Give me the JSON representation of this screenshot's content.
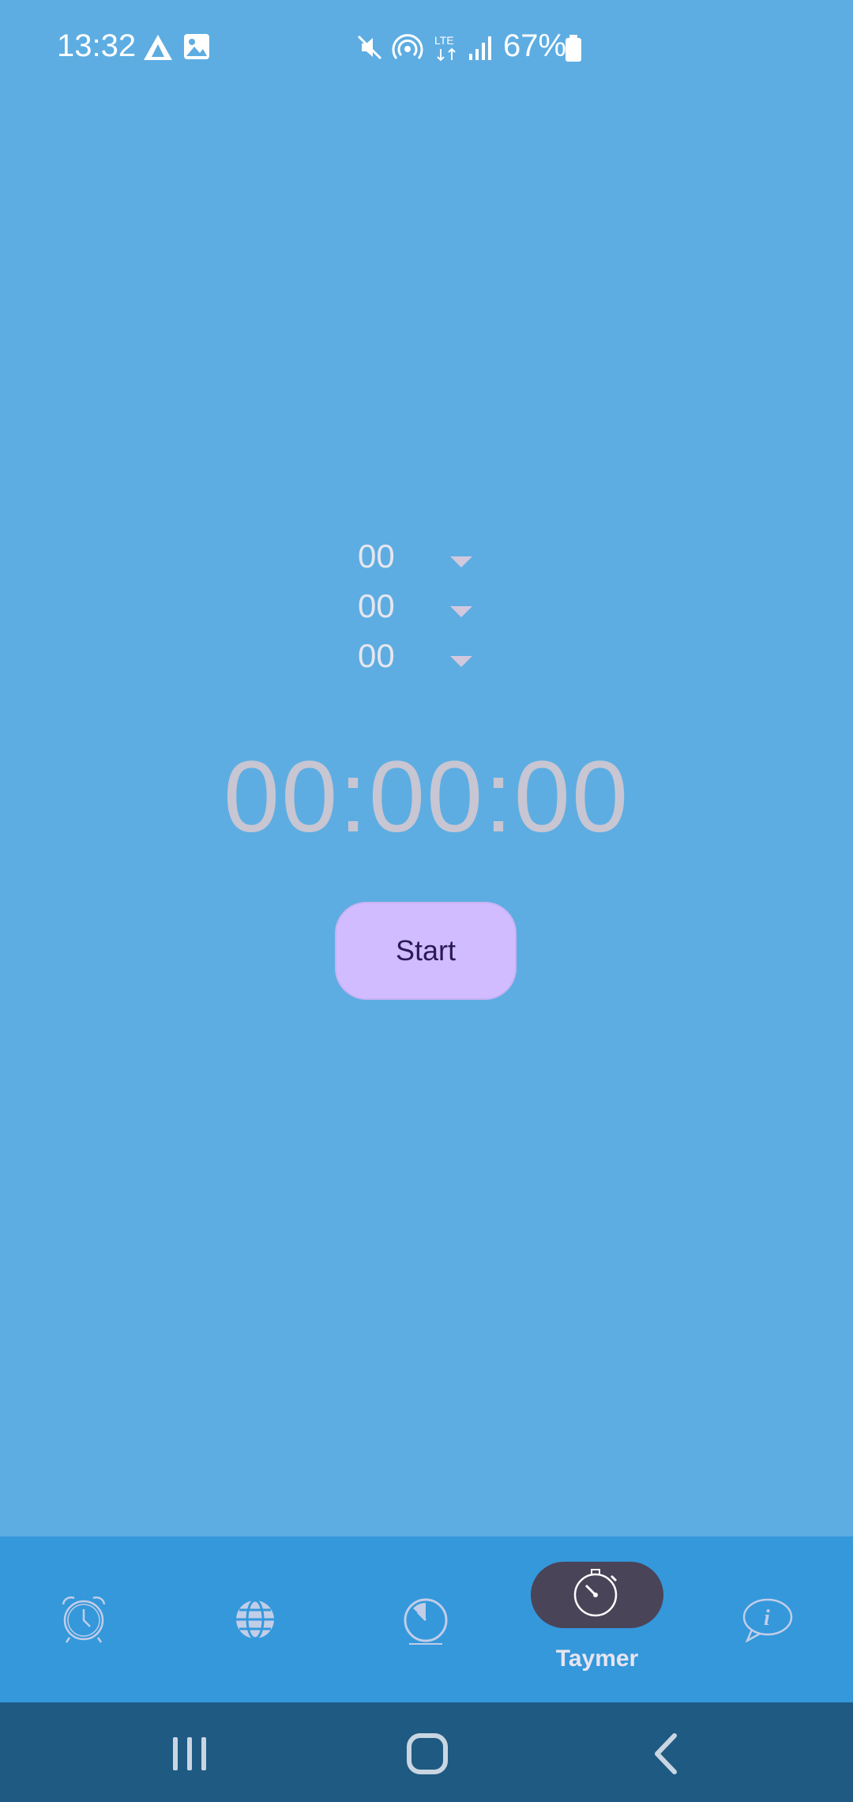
{
  "status_bar": {
    "time": "13:32",
    "battery_percent": "67%",
    "network_type": "LTE",
    "icons": [
      "drive-icon",
      "gallery-icon",
      "mute-icon",
      "hotspot-icon",
      "lte-icon",
      "signal-icon",
      "battery-icon"
    ]
  },
  "pickers": [
    {
      "value": "00",
      "icon": "dropdown-arrow-icon"
    },
    {
      "value": "00",
      "icon": "dropdown-arrow-icon"
    },
    {
      "value": "00",
      "icon": "dropdown-arrow-icon"
    }
  ],
  "timer": {
    "display": "00:00:00"
  },
  "start_button": {
    "label": "Start"
  },
  "bottom_nav": {
    "items": [
      {
        "icon": "alarm-clock-icon",
        "active": false
      },
      {
        "icon": "globe-icon",
        "active": false
      },
      {
        "icon": "clock-icon",
        "active": false
      },
      {
        "icon": "stopwatch-icon",
        "label": "Taymer",
        "active": true
      },
      {
        "icon": "info-chat-icon",
        "active": false
      }
    ]
  },
  "system_nav": {
    "icons": [
      "recents-icon",
      "home-icon",
      "back-icon"
    ]
  },
  "colors": {
    "background": "#5dade2",
    "bottom_nav": "#3498db",
    "system_nav": "#1f5a82",
    "accent_button": "#d0bcff",
    "active_pill": "#4a4458"
  }
}
